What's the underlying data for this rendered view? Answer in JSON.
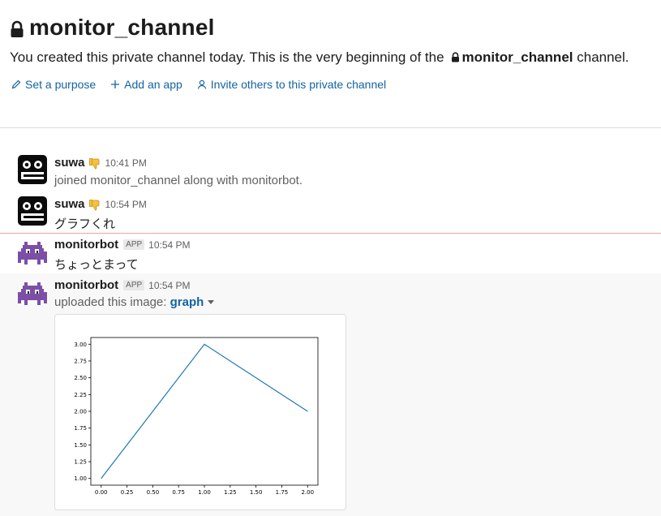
{
  "channel": {
    "name": "monitor_channel",
    "intro_prefix": "You created this private channel today. This is the very beginning of the",
    "intro_channel": "monitor_channel",
    "intro_suffix": "channel."
  },
  "actions": [
    {
      "label": "Set a purpose",
      "icon": "pencil-icon"
    },
    {
      "label": "Add an app",
      "icon": "plus-icon"
    },
    {
      "label": "Invite others to this private channel",
      "icon": "person-icon"
    }
  ],
  "messages": [
    {
      "user": "suwa",
      "time": "10:41 PM",
      "text": "joined monitor_channel along with monitorbot.",
      "avatar": "robot-face-avatar",
      "status_emoji": "thumbs-down-emoji"
    },
    {
      "user": "suwa",
      "time": "10:54 PM",
      "text": "グラフくれ",
      "avatar": "robot-face-avatar",
      "status_emoji": "thumbs-down-emoji"
    },
    {
      "user": "monitorbot",
      "badge": "APP",
      "time": "10:54 PM",
      "text": "ちょっとまって",
      "avatar": "space-invader-avatar"
    },
    {
      "user": "monitorbot",
      "badge": "APP",
      "time": "10:54 PM",
      "text_prefix": "uploaded this image:",
      "file_name": "graph",
      "avatar": "space-invader-avatar"
    }
  ],
  "colors": {
    "link": "#1264a3",
    "new_divider": "#e8a8a0",
    "line_series": "#1f77b4",
    "avatar_purple": "#7b4fa6"
  },
  "chart_data": {
    "type": "line",
    "x": [
      0.0,
      1.0,
      2.0
    ],
    "y": [
      1.0,
      3.0,
      2.0
    ],
    "xlim": [
      -0.1,
      2.1
    ],
    "ylim": [
      0.9,
      3.1
    ],
    "xticks": [
      "0.00",
      "0.25",
      "0.50",
      "0.75",
      "1.00",
      "1.25",
      "1.50",
      "1.75",
      "2.00"
    ],
    "yticks": [
      "1.00",
      "1.25",
      "1.50",
      "1.75",
      "2.00",
      "2.25",
      "2.50",
      "2.75",
      "3.00"
    ],
    "title": "",
    "xlabel": "",
    "ylabel": "",
    "grid": false
  }
}
